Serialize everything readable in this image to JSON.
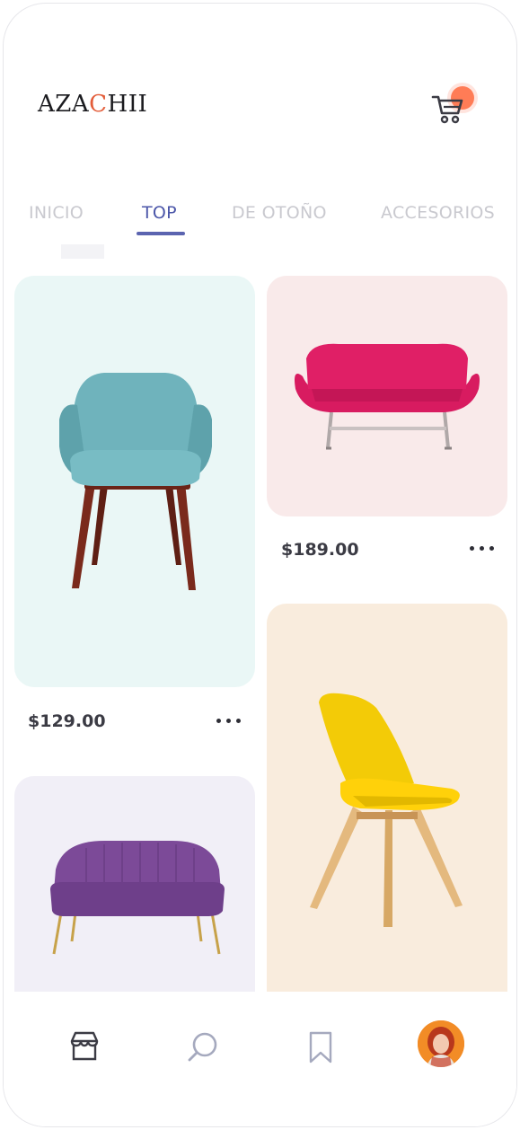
{
  "brand": {
    "logo_part1": "AZA",
    "logo_accent": "C",
    "logo_part2": "HII",
    "accent_color": "#e35d3a"
  },
  "header": {
    "cart_icon": "cart-icon",
    "cart_badge_color": "#ff7148"
  },
  "tabs": [
    {
      "label": "INICIO",
      "active": false
    },
    {
      "label": "TOP",
      "active": true
    },
    {
      "label": "DE OTOÑO",
      "active": false
    },
    {
      "label": "ACCESORIOS",
      "active": false
    }
  ],
  "products": [
    {
      "name": "teal-armchair",
      "price": "$129.00",
      "bg": "#eaf7f6"
    },
    {
      "name": "pink-sofa",
      "price": "$189.00",
      "bg": "#f9eaea"
    },
    {
      "name": "purple-loveseat",
      "price": "",
      "bg": "#f1eff7"
    },
    {
      "name": "yellow-chair",
      "price": "",
      "bg": "#f9ecdd"
    }
  ],
  "bottom_nav": [
    {
      "icon": "store-icon",
      "active": true
    },
    {
      "icon": "search-icon",
      "active": false
    },
    {
      "icon": "bookmark-icon",
      "active": false
    },
    {
      "icon": "avatar",
      "active": false
    }
  ]
}
